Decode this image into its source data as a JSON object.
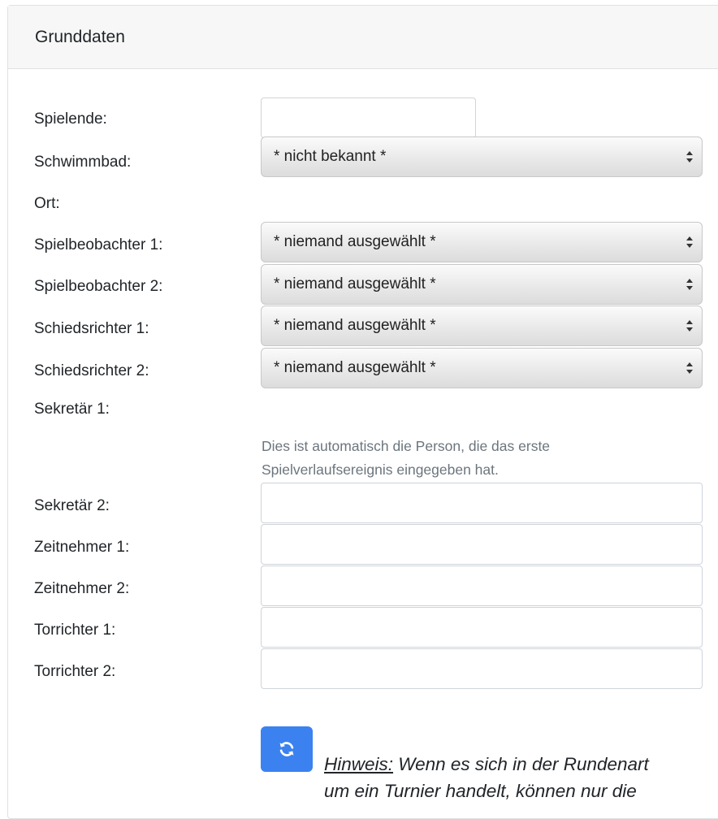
{
  "panel": {
    "title": "Grunddaten"
  },
  "fields": {
    "spielende": {
      "label": "Spielende:",
      "value": ""
    },
    "schwimmbad": {
      "label": "Schwimmbad:",
      "value": "* nicht bekannt *"
    },
    "ort": {
      "label": "Ort:"
    },
    "spielbeobachter1": {
      "label": "Spielbeobachter 1:",
      "value": "* niemand ausgewählt *"
    },
    "spielbeobachter2": {
      "label": "Spielbeobachter 2:",
      "value": "* niemand ausgewählt *"
    },
    "schiedsrichter1": {
      "label": "Schiedsrichter 1:",
      "value": "* niemand ausgewählt *"
    },
    "schiedsrichter2": {
      "label": "Schiedsrichter 2:",
      "value": "* niemand ausgewählt *"
    },
    "sekretaer1": {
      "label": "Sekretär 1:",
      "help": "Dies ist automatisch die Person, die das erste Spielverlaufsereignis eingegeben hat."
    },
    "sekretaer2": {
      "label": "Sekretär 2:",
      "value": ""
    },
    "zeitnehmer1": {
      "label": "Zeitnehmer 1:",
      "value": ""
    },
    "zeitnehmer2": {
      "label": "Zeitnehmer 2:",
      "value": ""
    },
    "torrichter1": {
      "label": "Torrichter 1:",
      "value": ""
    },
    "torrichter2": {
      "label": "Torrichter 2:",
      "value": ""
    }
  },
  "hint": {
    "prefix": "Hinweis:",
    "line1": " Wenn es sich in der Rundenart",
    "line2": "um ein Turnier handelt, können nur die"
  },
  "icons": {
    "refresh": "refresh-icon",
    "select_arrow": "updown-arrows-icon"
  },
  "colors": {
    "accent": "#3b82f0",
    "help_text": "#6c757d",
    "header_bg": "#f7f7f7"
  }
}
